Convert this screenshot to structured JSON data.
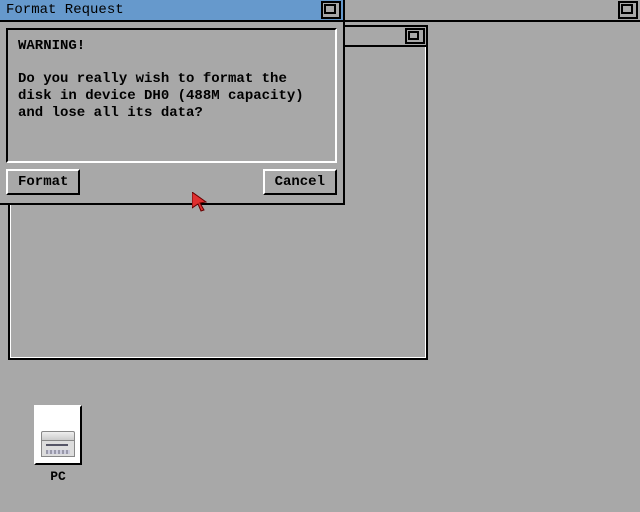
{
  "dialog": {
    "title": "Format Request",
    "warning": "WARNING!",
    "message": "Do you really wish to format the\ndisk in device DH0 (488M capacity)\nand lose all its data?",
    "format_label": "Format",
    "cancel_label": "Cancel"
  },
  "desktop": {
    "icons": [
      {
        "label": "PC"
      }
    ]
  }
}
